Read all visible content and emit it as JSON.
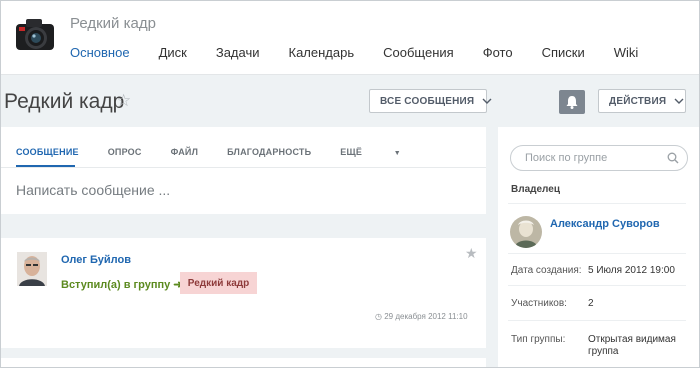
{
  "header": {
    "group_name": "Редкий кадр",
    "nav": [
      "Основное",
      "Диск",
      "Задачи",
      "Календарь",
      "Сообщения",
      "Фото",
      "Списки",
      "Wiki"
    ],
    "active_nav_index": 0
  },
  "title_bar": {
    "title": "Редкий кадр",
    "all_messages_label": "ВСЕ СООБЩЕНИЯ",
    "actions_label": "ДЕЙСТВИЯ"
  },
  "composer": {
    "tabs": [
      "СООБЩЕНИЕ",
      "ОПРОС",
      "ФАЙЛ",
      "БЛАГОДАРНОСТЬ",
      "ЕЩЁ"
    ],
    "placeholder": "Написать сообщение ..."
  },
  "post": {
    "author": "Олег Буйлов",
    "action": "Вступил(а) в группу",
    "group": "Редкий кадр",
    "date": "29 декабря 2012 11:10"
  },
  "sidebar": {
    "search_placeholder": "Поиск по группе",
    "owner_label": "Владелец",
    "owner_name": "Александр Суворов",
    "created_label": "Дата создания:",
    "created_value": "5 Июля 2012 19:00",
    "members_label": "Участников:",
    "members_value": "2",
    "type_label": "Тип группы:",
    "type_value_line1": "Открытая видимая",
    "type_value_line2": "группа"
  },
  "colors": {
    "accent": "#2067b0",
    "joined_green": "#5c8a1f",
    "group_badge_bg": "#f7d4d4"
  }
}
